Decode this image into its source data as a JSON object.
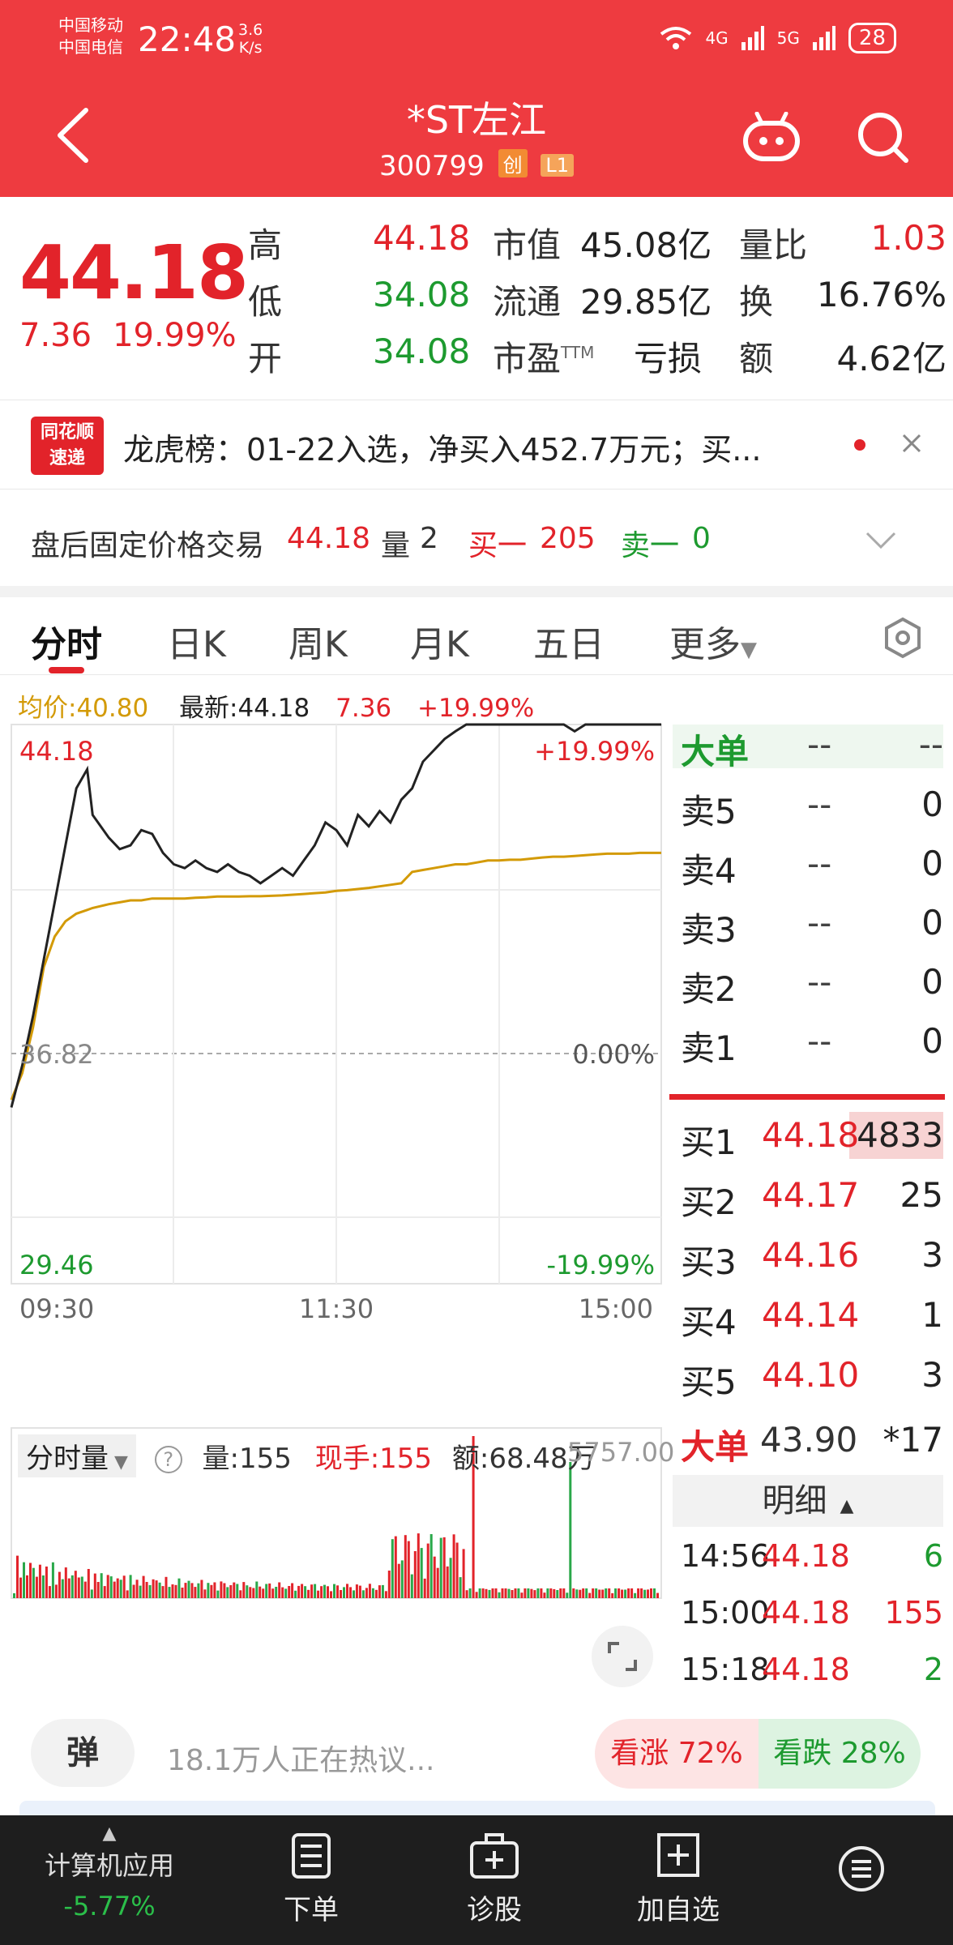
{
  "status_bar": {
    "carrier1": "中国移动",
    "carrier2": "中国电信",
    "time": "22:48",
    "speed_value": "3.6",
    "speed_unit": "K/s",
    "net1": "4G",
    "net2": "5G",
    "battery": "28"
  },
  "header": {
    "title": "*ST左江",
    "code": "300799",
    "tag_board": "创",
    "tag_level": "L1"
  },
  "quote": {
    "price": "44.18",
    "change": "7.36",
    "change_pct": "19.99%",
    "high_label": "高",
    "high": "44.18",
    "low_label": "低",
    "low": "34.08",
    "open_label": "开",
    "open": "34.08",
    "mktcap_label": "市值",
    "mktcap": "45.08亿",
    "float_label": "流通",
    "float": "29.85亿",
    "pe_label": "市盈",
    "pe_sup": "TTM",
    "pe": "亏损",
    "volratio_label": "量比",
    "volratio": "1.03",
    "turnover_label": "换",
    "turnover": "16.76%",
    "amount_label": "额",
    "amount": "4.62亿"
  },
  "news": {
    "logo_line1": "同花顺",
    "logo_line2": "速递",
    "text": "龙虎榜：01-22入选，净买入452.7万元；买..."
  },
  "after_hours": {
    "label": "盘后固定价格交易",
    "price": "44.18",
    "vol_label": "量",
    "vol": "2",
    "bid_label": "买一",
    "bid": "205",
    "ask_label": "卖一",
    "ask": "0"
  },
  "tabs": [
    {
      "label": "分时"
    },
    {
      "label": "日K"
    },
    {
      "label": "周K"
    },
    {
      "label": "月K"
    },
    {
      "label": "五日"
    },
    {
      "label": "更多"
    }
  ],
  "chart_header": {
    "avg": "均价:40.80",
    "latest": "最新:44.18",
    "change": "7.36",
    "pct": "+19.99%"
  },
  "chart_data": {
    "type": "line",
    "y_top": "44.18",
    "y_mid": "36.82",
    "y_bottom": "29.46",
    "pct_top": "+19.99%",
    "pct_mid": "0.00%",
    "pct_bottom": "-19.99%",
    "x_ticks": [
      "09:30",
      "11:30",
      "15:00"
    ],
    "ylim": [
      29.46,
      44.18
    ],
    "x": [
      0,
      4,
      8,
      12,
      16,
      20,
      24,
      28,
      30,
      33,
      36,
      40,
      44,
      48,
      52,
      56,
      60,
      64,
      68,
      72,
      76,
      80,
      84,
      88,
      92,
      96,
      100,
      104,
      108,
      112,
      116,
      120,
      124,
      128,
      132,
      136,
      140,
      144,
      148,
      152,
      156,
      160,
      164,
      168,
      172,
      176,
      180,
      184,
      188,
      192,
      196,
      200,
      204,
      208,
      212,
      216,
      220,
      224,
      228,
      232,
      236,
      240
    ],
    "series": [
      {
        "name": "价格",
        "values": [
          34.1,
          35.2,
          36.5,
          38.0,
          39.5,
          41.0,
          42.5,
          43.0,
          41.8,
          41.5,
          41.2,
          40.9,
          41.0,
          41.4,
          41.3,
          40.8,
          40.5,
          40.4,
          40.6,
          40.4,
          40.3,
          40.5,
          40.3,
          40.2,
          40.0,
          40.2,
          40.4,
          40.2,
          40.6,
          41.0,
          41.6,
          41.4,
          41.0,
          41.8,
          41.5,
          41.9,
          41.6,
          42.2,
          42.5,
          43.2,
          43.5,
          43.8,
          44.0,
          44.18,
          44.18,
          44.18,
          44.18,
          44.18,
          44.18,
          44.18,
          44.18,
          44.18,
          44.18,
          44.0,
          44.18,
          44.18,
          44.18,
          44.18,
          44.18,
          44.18,
          44.18,
          44.18
        ]
      },
      {
        "name": "均价",
        "values": [
          34.3,
          35.0,
          36.2,
          37.8,
          38.6,
          39.0,
          39.2,
          39.3,
          39.35,
          39.4,
          39.45,
          39.5,
          39.55,
          39.55,
          39.6,
          39.6,
          39.6,
          39.6,
          39.62,
          39.63,
          39.65,
          39.65,
          39.65,
          39.66,
          39.66,
          39.67,
          39.68,
          39.7,
          39.72,
          39.74,
          39.76,
          39.8,
          39.82,
          39.85,
          39.88,
          39.92,
          39.96,
          40.0,
          40.3,
          40.35,
          40.4,
          40.45,
          40.5,
          40.5,
          40.55,
          40.6,
          40.6,
          40.62,
          40.62,
          40.65,
          40.68,
          40.7,
          40.7,
          40.72,
          40.74,
          40.76,
          40.78,
          40.78,
          40.78,
          40.8,
          40.8,
          40.8
        ]
      }
    ]
  },
  "book": {
    "big_label": "大单",
    "dash": "--",
    "asks": [
      {
        "label": "卖5",
        "price": "--",
        "vol": "0"
      },
      {
        "label": "卖4",
        "price": "--",
        "vol": "0"
      },
      {
        "label": "卖3",
        "price": "--",
        "vol": "0"
      },
      {
        "label": "卖2",
        "price": "--",
        "vol": "0"
      },
      {
        "label": "卖1",
        "price": "--",
        "vol": "0"
      }
    ],
    "bids": [
      {
        "label": "买1",
        "price": "44.18",
        "vol": "4833"
      },
      {
        "label": "买2",
        "price": "44.17",
        "vol": "25"
      },
      {
        "label": "买3",
        "price": "44.16",
        "vol": "3"
      },
      {
        "label": "买4",
        "price": "44.14",
        "vol": "1"
      },
      {
        "label": "买5",
        "price": "44.10",
        "vol": "3"
      }
    ],
    "big_bottom_price": "43.90",
    "big_bottom_vol": "*17",
    "detail_label": "明细",
    "trades": [
      {
        "time": "14:56",
        "price": "44.18",
        "vol": "6",
        "dir": "buy"
      },
      {
        "time": "15:00",
        "price": "44.18",
        "vol": "155",
        "dir": "sell"
      },
      {
        "time": "15:18",
        "price": "44.18",
        "vol": "2",
        "dir": "buy"
      }
    ]
  },
  "volume": {
    "selector": "分时量",
    "vol": "量:155",
    "current": "现手:155",
    "amount": "额:68.48万",
    "max": "5757.00"
  },
  "discuss": {
    "danmaku_label": "弹",
    "text": "18.1万人正在热议...",
    "bull": "看涨 72%",
    "bear": "看跌 28%"
  },
  "bottom_nav": {
    "sector": "计算机应用",
    "sector_pct": "-5.77%",
    "items": [
      "下单",
      "诊股",
      "加自选"
    ]
  }
}
